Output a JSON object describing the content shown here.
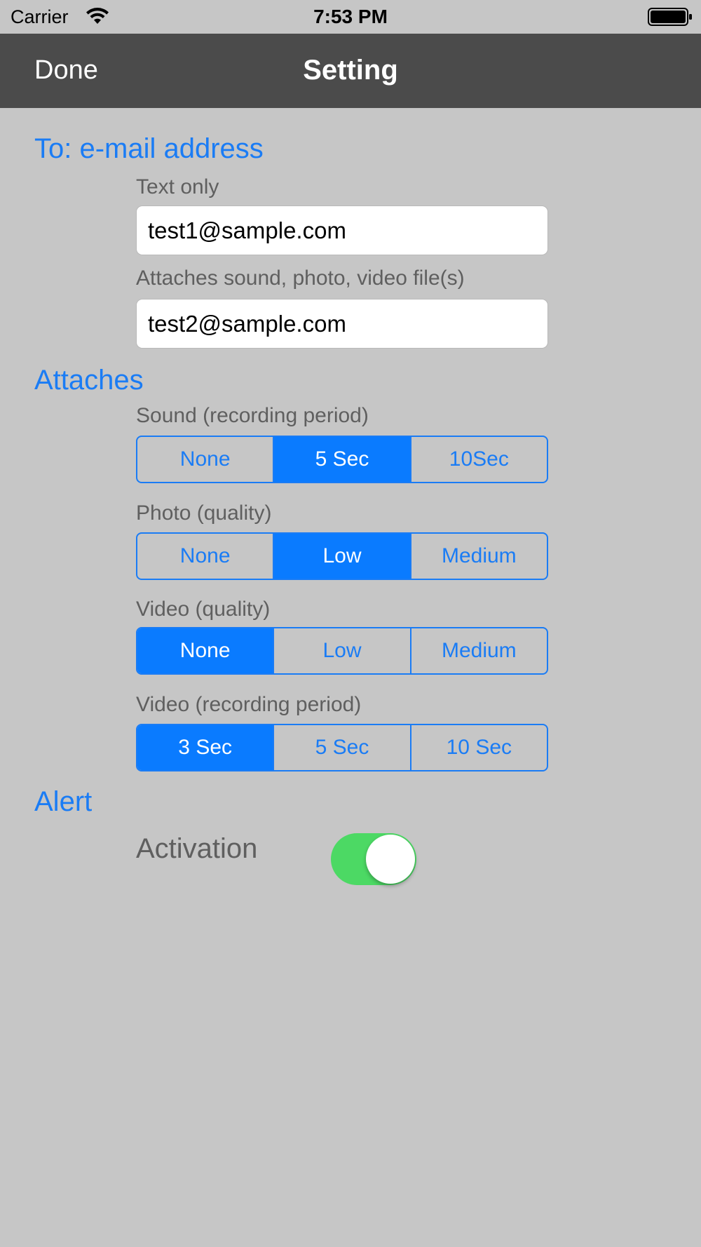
{
  "status_bar": {
    "carrier": "Carrier",
    "time": "7:53 PM",
    "icons": [
      "wifi-icon",
      "battery-icon"
    ]
  },
  "nav": {
    "done_label": "Done",
    "title": "Setting"
  },
  "email_section": {
    "header": "To: e-mail address",
    "text_only_label": "Text only",
    "text_only_value": "test1@sample.com",
    "attaches_label": "Attaches sound, photo, video file(s)",
    "attaches_value": "test2@sample.com"
  },
  "attaches_section": {
    "header": "Attaches",
    "sound": {
      "label": "Sound (recording period)",
      "options": [
        "None",
        "5 Sec",
        "10Sec"
      ],
      "selected": "5 Sec"
    },
    "photo": {
      "label": "Photo (quality)",
      "options": [
        "None",
        "Low",
        "Medium"
      ],
      "selected": "Low"
    },
    "video_quality": {
      "label": "Video (quality)",
      "options": [
        "None",
        "Low",
        "Medium"
      ],
      "selected": "None"
    },
    "video_period": {
      "label": "Video (recording period)",
      "options": [
        "3 Sec",
        "5 Sec",
        "10 Sec"
      ],
      "selected": "3 Sec"
    }
  },
  "alert_section": {
    "header": "Alert",
    "activation_label": "Activation",
    "activation_on": true
  },
  "colors": {
    "accent": "#1a7cf5",
    "nav_bg": "#4b4b4b",
    "page_bg": "#c6c6c6",
    "toggle_on": "#4cd964"
  }
}
